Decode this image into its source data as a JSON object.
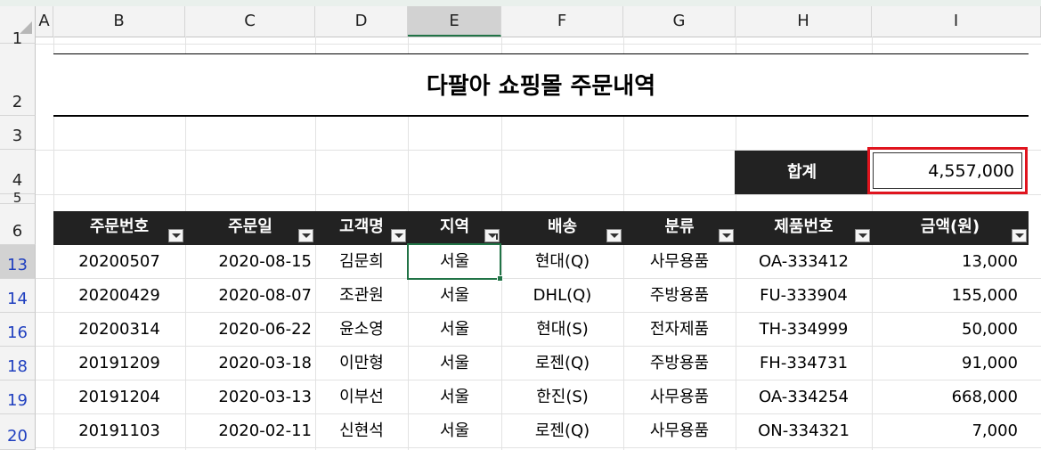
{
  "columns": [
    "A",
    "B",
    "C",
    "D",
    "E",
    "F",
    "G",
    "H",
    "I"
  ],
  "rows": [
    "1",
    "2",
    "3",
    "4",
    "5",
    "6",
    "13",
    "14",
    "16",
    "18",
    "19",
    "20"
  ],
  "title": "다팔아 쇼핑몰 주문내역",
  "summary": {
    "label": "합계",
    "value": "4,557,000"
  },
  "table": {
    "headers": [
      "주문번호",
      "주문일",
      "고객명",
      "지역",
      "배송",
      "분류",
      "제품번호",
      "금액(원)"
    ],
    "rows": [
      [
        "20200507",
        "2020-08-15",
        "김문희",
        "서울",
        "현대(Q)",
        "사무용품",
        "OA-333412",
        "13,000"
      ],
      [
        "20200429",
        "2020-08-07",
        "조관원",
        "서울",
        "DHL(Q)",
        "주방용품",
        "FU-333904",
        "155,000"
      ],
      [
        "20200314",
        "2020-06-22",
        "윤소영",
        "서울",
        "현대(S)",
        "전자제품",
        "TH-334999",
        "50,000"
      ],
      [
        "20191209",
        "2020-03-18",
        "이만형",
        "서울",
        "로젠(Q)",
        "주방용품",
        "FH-334731",
        "91,000"
      ],
      [
        "20191204",
        "2020-03-13",
        "이부선",
        "서울",
        "한진(S)",
        "사무용품",
        "OA-334254",
        "668,000"
      ],
      [
        "20191103",
        "2020-02-11",
        "신현석",
        "서울",
        "로젠(Q)",
        "사무용품",
        "ON-334321",
        "7,000"
      ]
    ]
  },
  "selected_cell": "E13",
  "colors": {
    "header_bg": "#222222",
    "highlight_border": "#e0141e",
    "selection": "#217346",
    "filtered_row_num": "#1f3fbf"
  }
}
